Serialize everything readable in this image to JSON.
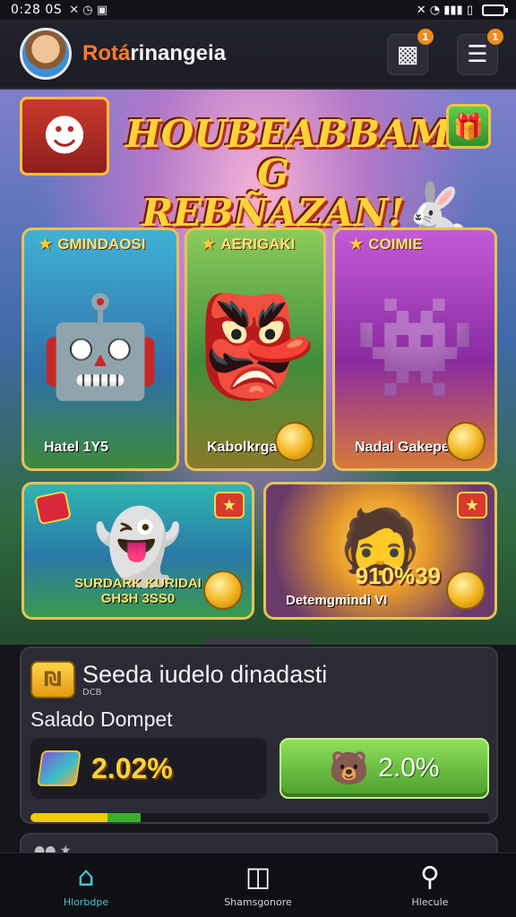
{
  "status": {
    "time": "0:28 0S",
    "left_icons": "✕ ◷ ▣",
    "right_icons": "✕ ◔ ▮▮▮ ▯"
  },
  "header": {
    "brand_part1": "Rotá",
    "brand_part2": "rinangeia",
    "bag_badge": "1",
    "menu_badge": "1"
  },
  "hero": {
    "headline_line1": "HOUBEABBAM G",
    "headline_line2": "REBÑAZAN!"
  },
  "cards": [
    {
      "title": "GMINDAOSI",
      "footer": "Hatel 1Y5"
    },
    {
      "title": "AERIGAKI",
      "footer": "Kabolkrgan"
    },
    {
      "title": "COIMIE",
      "footer": "Nadal Gakepeorni"
    }
  ],
  "promo_left": {
    "line1": "SURDARK KURIDAI",
    "line2": "GH3H 3SS0"
  },
  "promo_right": {
    "value": "910%39",
    "footer": "Detemgmindi VI"
  },
  "wallet": {
    "title": "Seeda iudelo dinadasti",
    "subtitle": "DCB",
    "label": "Salado Dompet",
    "balance": "2.02%",
    "button_value": "2.0%",
    "progress_percent": 24
  },
  "nav": {
    "items": [
      {
        "label": "Hlorbdpe",
        "icon": "home-icon"
      },
      {
        "label": "Shamsgonore",
        "icon": "store-icon"
      },
      {
        "label": "Hlecule",
        "icon": "search-icon"
      }
    ]
  },
  "colors": {
    "accent": "#3ec6d0",
    "brand": "#ff7a2a",
    "button": "#6cc64a",
    "gold": "#ffd23a"
  }
}
